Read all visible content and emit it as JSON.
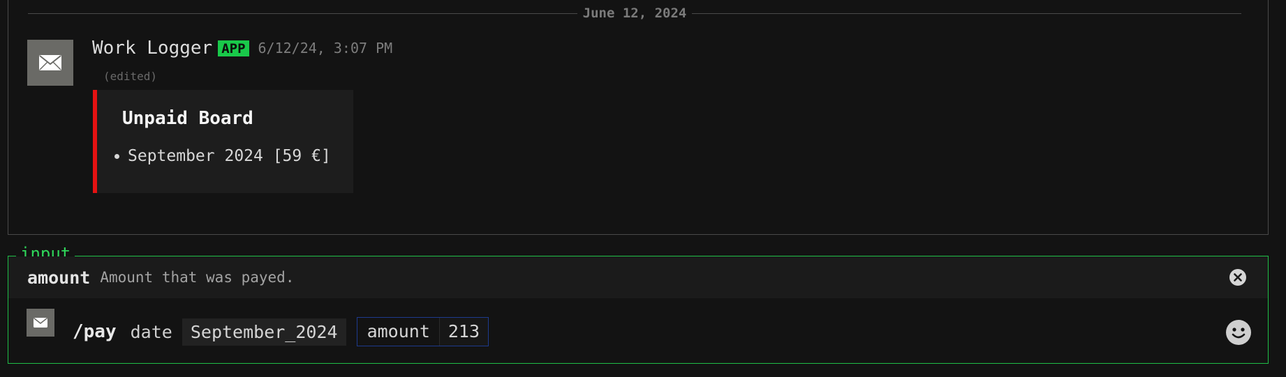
{
  "date_divider": "June 12, 2024",
  "message": {
    "avatar_icon": "envelope-icon",
    "author": "Work Logger",
    "badge": "APP",
    "timestamp": "6/12/24, 3:07 PM",
    "edited": "(edited)",
    "embed": {
      "accent_color": "#e51212",
      "title": "Unpaid Board",
      "items": [
        "September 2024 [59 €]"
      ]
    }
  },
  "input": {
    "legend": "input",
    "border_color": "#1fbe47",
    "hint": {
      "option_name": "amount",
      "description": "Amount that was payed.",
      "close_icon": "close-circle-icon"
    },
    "command": {
      "avatar_icon": "envelope-icon",
      "name": "/pay",
      "options": [
        {
          "name": "date",
          "value": "September_2024"
        },
        {
          "name": "amount",
          "value": "213",
          "active": true
        }
      ]
    },
    "emoji_icon": "smiley-icon"
  },
  "colors": {
    "background": "#131313",
    "app_badge": "#19c94a",
    "active_option_border": "#1d3a8e"
  }
}
